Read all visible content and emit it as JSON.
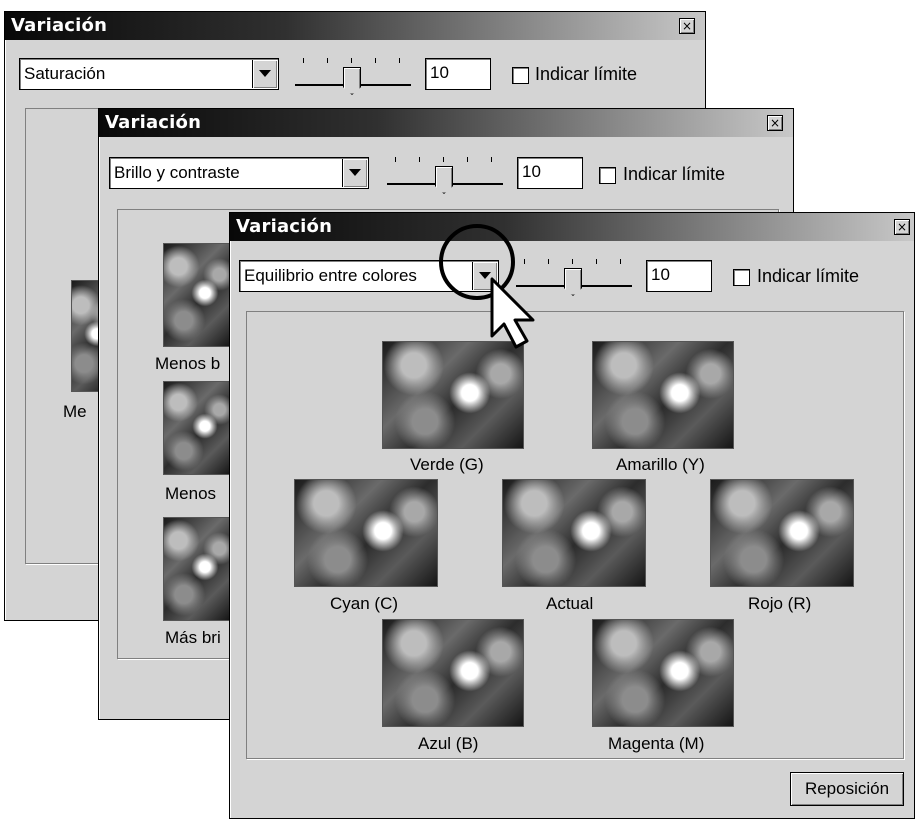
{
  "window_back": {
    "title": "Variación",
    "close": "×",
    "mode": "Saturación",
    "value": "10",
    "indicate_limit": "Indicar límite",
    "captions": [
      "Me"
    ]
  },
  "window_mid": {
    "title": "Variación",
    "close": "×",
    "mode": "Brillo y contraste",
    "value": "10",
    "indicate_limit": "Indicar límite",
    "captions": [
      "Menos b",
      "Menos",
      "Más bri"
    ]
  },
  "window_front": {
    "title": "Variación",
    "close": "×",
    "mode": "Equilibrio entre colores",
    "value": "10",
    "indicate_limit": "Indicar límite",
    "variations": {
      "green": "Verde (G)",
      "yellow": "Amarillo (Y)",
      "cyan": "Cyan (C)",
      "current": "Actual",
      "red": "Rojo (R)",
      "blue": "Azul (B)",
      "magenta": "Magenta (M)"
    },
    "reset_label": "Reposición"
  },
  "slider_level_fraction": 0.5,
  "annotation": {
    "highlight_icon": "circle-callout",
    "cursor_icon": "arrow-cursor"
  }
}
